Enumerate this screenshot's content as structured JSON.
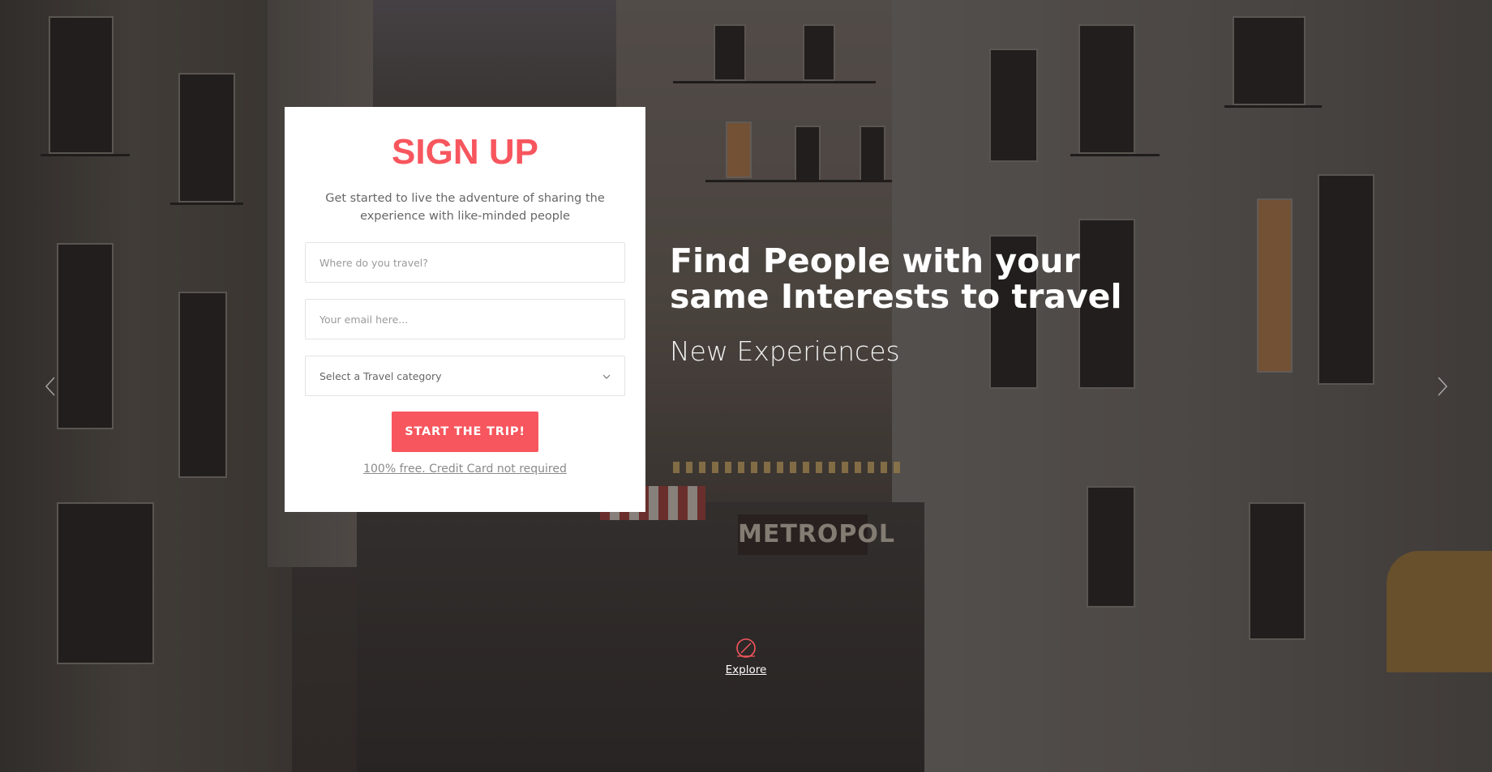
{
  "signup": {
    "title": "SIGN UP",
    "subtitle": "Get started to live the adventure of sharing the experience with like-minded people",
    "destination_placeholder": "Where do you travel?",
    "email_placeholder": "Your email here...",
    "category_select": "Select a Travel category",
    "submit_label": "START THE TRIP!",
    "free_note": "100% free. Credit Card not required"
  },
  "hero": {
    "headline": "Find People with your same Interests to travel",
    "tagline": "New Experiences"
  },
  "carousel": {
    "prev_icon": "chevron-left-icon",
    "next_icon": "chevron-right-icon"
  },
  "explore": {
    "label": "Explore",
    "icon": "compass-icon"
  },
  "colors": {
    "accent": "#f7565e",
    "card_background": "#ffffff",
    "hero_text": "#ffffff"
  }
}
